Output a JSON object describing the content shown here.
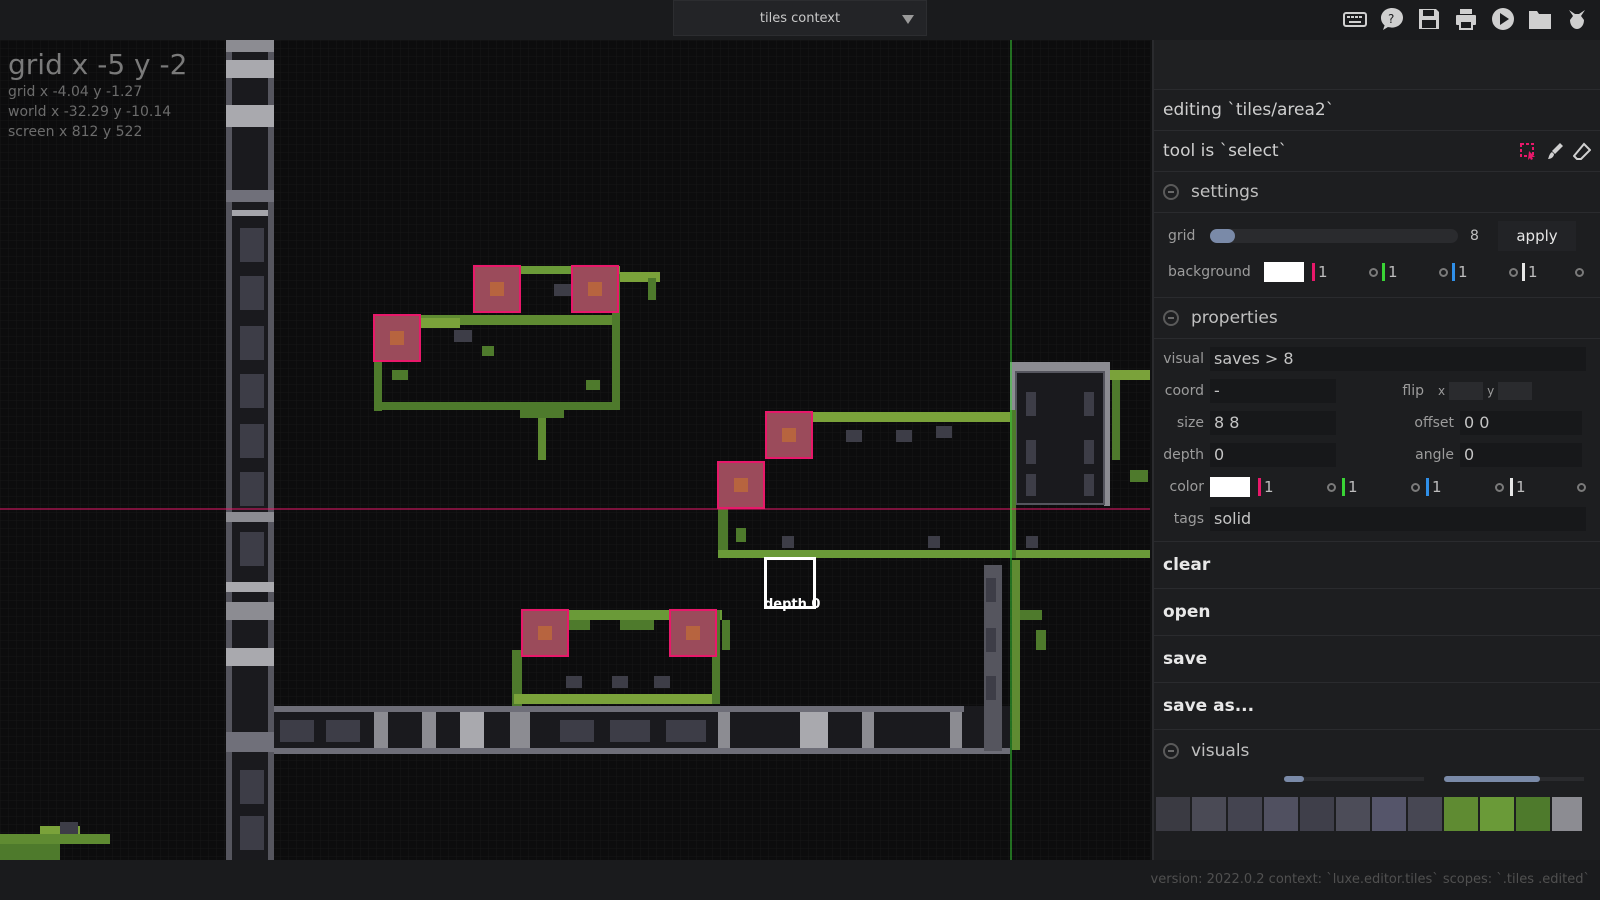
{
  "topbar": {
    "context_label": "tiles context",
    "tools": [
      "keyboard-icon",
      "help-icon",
      "save-disk-icon",
      "printer-icon",
      "play-icon",
      "folder-icon",
      "luxe-logo-icon"
    ]
  },
  "viewport": {
    "grid_big": "grid x -5 y -2",
    "grid_fine": "grid x -4.04 y -1.27",
    "world": "world x -32.29 y -10.14",
    "screen": "screen x 812 y 522",
    "cursor_label": "depth 0",
    "colors": {
      "highlight": "#e8186a",
      "axis_x": "#e8186a",
      "axis_y": "#39d335",
      "moss": "#4e7a2c",
      "stone": "#6e6e78"
    }
  },
  "panel": {
    "editing": "editing `tiles/area2`",
    "tool": "tool is `select`",
    "settings": {
      "title": "settings",
      "grid_label": "grid",
      "grid_value": "8",
      "grid_slider": 0.1,
      "apply": "apply",
      "background_label": "background",
      "bg_channels": [
        "1",
        "1",
        "1",
        "1"
      ]
    },
    "properties": {
      "title": "properties",
      "visual_label": "visual",
      "visual_value": "saves > 8",
      "coord_label": "coord",
      "coord_value": "-",
      "flip_label": "flip",
      "flip_x": "x",
      "flip_y": "y",
      "size_label": "size",
      "size_value": "8 8",
      "offset_label": "offset",
      "offset_value": "0 0",
      "depth_label": "depth",
      "depth_value": "0",
      "angle_label": "angle",
      "angle_value": "0",
      "color_label": "color",
      "color_channels": [
        "1",
        "1",
        "1",
        "1"
      ],
      "tags_label": "tags",
      "tags_value": "solid"
    },
    "actions": [
      "clear",
      "open",
      "save",
      "save as..."
    ],
    "visuals_title": "visuals"
  },
  "status": "version: 2022.0.2 context: `luxe.editor.tiles` scopes: `.tiles .edited`"
}
